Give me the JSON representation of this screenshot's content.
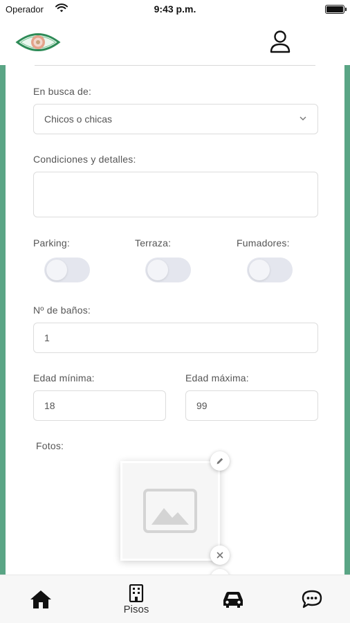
{
  "status_bar": {
    "carrier": "Operador",
    "time": "9:43 p.m."
  },
  "app_bar": {
    "logo_icon": "eye-logo-icon",
    "user_icon": "user-icon"
  },
  "form": {
    "looking_for": {
      "label": "En busca de:",
      "value": "Chicos o chicas"
    },
    "conditions": {
      "label": "Condiciones y detalles:",
      "value": ""
    },
    "toggles": [
      {
        "label": "Parking:",
        "on": false
      },
      {
        "label": "Terraza:",
        "on": false
      },
      {
        "label": "Fumadores:",
        "on": false
      }
    ],
    "bathrooms": {
      "label": "Nº de baños:",
      "value": "1"
    },
    "min_age": {
      "label": "Edad mínima:",
      "value": "18"
    },
    "max_age": {
      "label": "Edad máxima:",
      "value": "99"
    },
    "photos": {
      "label": "Fotos:"
    }
  },
  "bottom_nav": [
    {
      "icon": "home-icon",
      "label": ""
    },
    {
      "icon": "building-icon",
      "label": "Pisos"
    },
    {
      "icon": "car-icon",
      "label": ""
    },
    {
      "icon": "chat-icon",
      "label": ""
    }
  ],
  "colors": {
    "accent": "#5aa585",
    "toggle_off": "#e4e6ee"
  }
}
